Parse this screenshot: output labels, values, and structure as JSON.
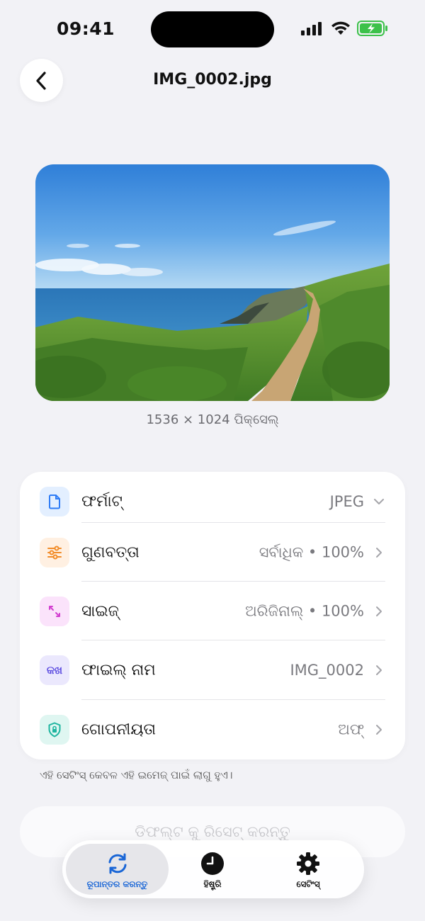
{
  "status_bar": {
    "time": "09:41"
  },
  "header": {
    "title": "IMG_0002.jpg"
  },
  "image": {
    "dimensions": "1536 × 1024 ପିକ୍ସେଲ୍"
  },
  "settings": {
    "rows": [
      {
        "label": "ଫର୍ମାଟ୍",
        "value": "JPEG",
        "icon": "document-icon",
        "color": "#2e7cf6"
      },
      {
        "label": "ଗୁଣବତ୍ତା",
        "value": "ସର୍ବାଧିକ • 100%",
        "icon": "sliders-icon",
        "color": "#f28c28"
      },
      {
        "label": "ସାଇଜ୍",
        "value": "ଅରିଜିନାଲ୍ • 100%",
        "icon": "resize-icon",
        "color": "#d23fd0"
      },
      {
        "label": "ଫାଇଲ୍ ନାମ",
        "value": "IMG_0002",
        "icon": "text-icon",
        "icon_text": "କଖ",
        "color": "#5b4be0"
      },
      {
        "label": "ଗୋପନୀୟତା",
        "value": "ଅଫ୍",
        "icon": "privacy-lock-icon",
        "color": "#1fb5a0"
      }
    ]
  },
  "note": "ଏହି ସେଟିଂସ୍ କେବଳ ଏହି ଇମେଜ୍ ପାଇଁ ଲାଗୁ ହୁଏ।",
  "reset_button": "ଡିଫଲ୍ଟ କୁ ରିସେଟ୍ କରନ୍ତୁ",
  "tabbar": {
    "tabs": [
      {
        "label": "ରୂପାନ୍ତର କରନ୍ତୁ",
        "icon": "convert-arrows-icon",
        "active": true
      },
      {
        "label": "ହିଷ୍ଟ୍ରି",
        "icon": "clock-icon",
        "active": false
      },
      {
        "label": "ସେଟିଂସ୍",
        "icon": "gear-icon",
        "active": false
      }
    ]
  }
}
